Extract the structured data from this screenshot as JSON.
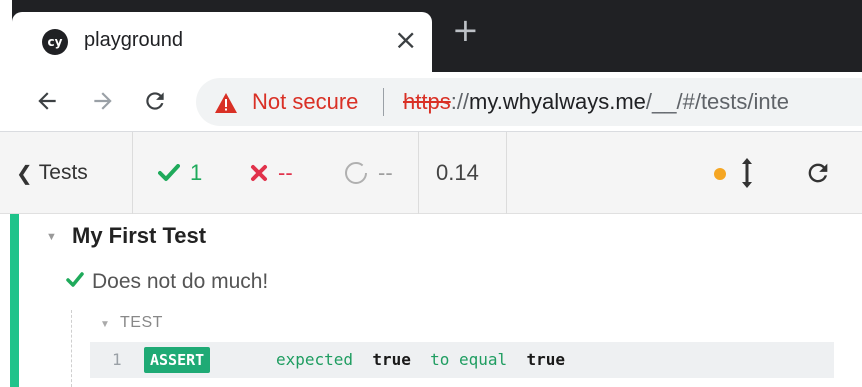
{
  "browser": {
    "tab": {
      "favicon_text": "cy",
      "title": "playground",
      "close_glyph": "×"
    },
    "new_tab_glyph": "+",
    "address": {
      "security_label": "Not secure",
      "url_scheme": "https",
      "url_after_scheme": "://",
      "url_host": "my.whyalways.me",
      "url_path": "/__/#/tests/inte"
    },
    "icons": {
      "back": "back-arrow-icon",
      "forward": "forward-arrow-icon",
      "reload": "reload-icon",
      "warning": "warning-triangle-icon"
    }
  },
  "reporter": {
    "tests_label": "Tests",
    "stats": {
      "passed": "1",
      "failed": "--",
      "pending": "--"
    },
    "duration": "0.14",
    "colors": {
      "passed": "#1faa5b",
      "failed": "#e1324b",
      "pending": "#9e9e9e",
      "dot": "#f5a623"
    }
  },
  "suite": {
    "title": "My First Test",
    "test": {
      "title": "Does not do much!",
      "hook_label": "TEST",
      "commands": [
        {
          "number": "1",
          "name": "ASSERT",
          "msg_pre": "expected",
          "msg_val1": "true",
          "msg_mid": "to equal",
          "msg_val2": "true"
        }
      ]
    }
  }
}
